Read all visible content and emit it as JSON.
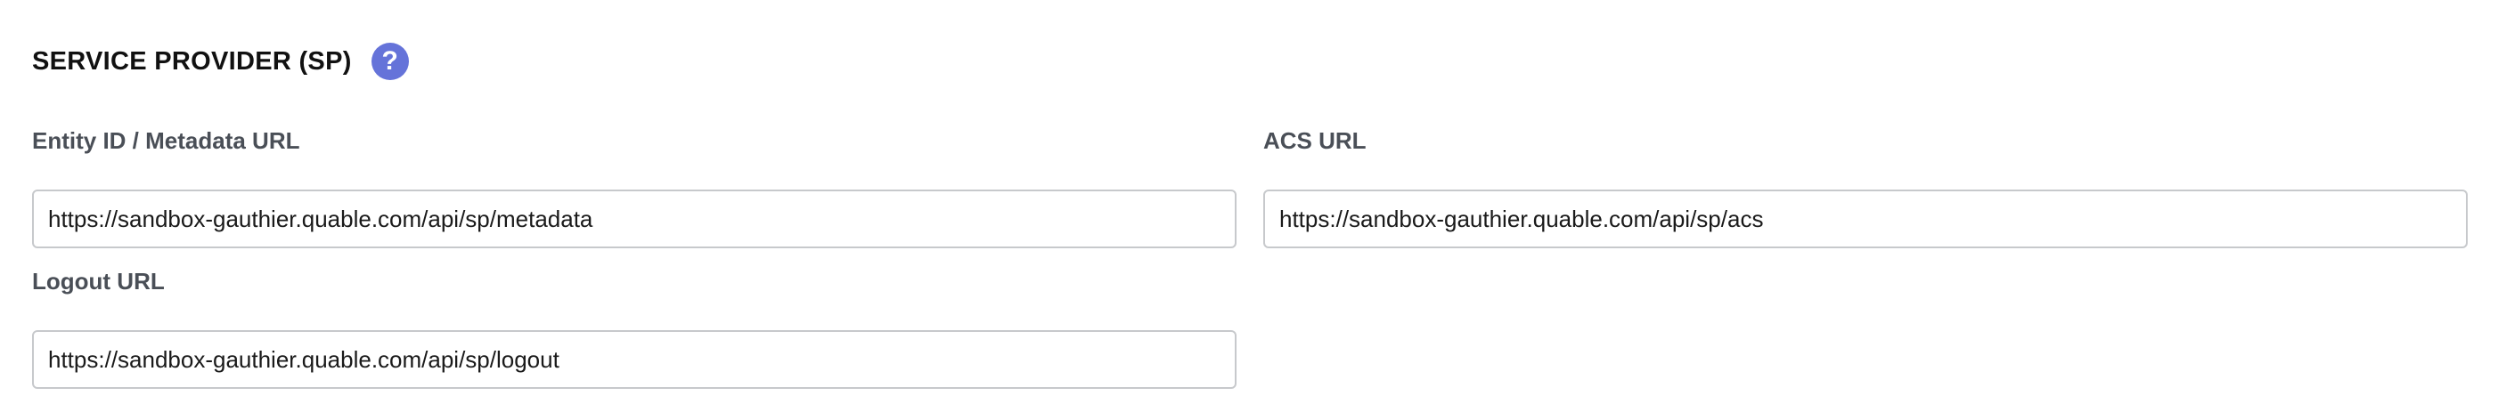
{
  "section": {
    "title": "SERVICE PROVIDER (SP)",
    "help_glyph": "?",
    "help_icon": "question-circle-icon",
    "accent_color": "#6573d9"
  },
  "fields": {
    "entity_id": {
      "label": "Entity ID / Metadata URL",
      "value": "https://sandbox-gauthier.quable.com/api/sp/metadata"
    },
    "acs_url": {
      "label": "ACS URL",
      "value": "https://sandbox-gauthier.quable.com/api/sp/acs"
    },
    "logout_url": {
      "label": "Logout URL",
      "value": "https://sandbox-gauthier.quable.com/api/sp/logout"
    }
  }
}
